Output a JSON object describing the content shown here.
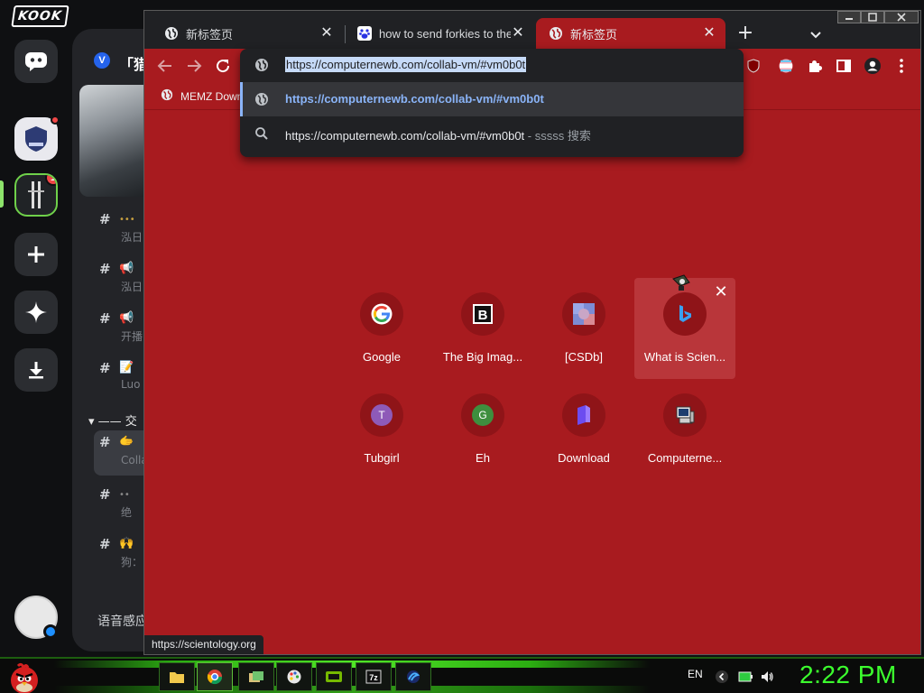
{
  "kook": {
    "logo": "KOOK",
    "server_badge": "1",
    "guild_letter": "V",
    "guild_name": "「猎",
    "channels": [
      {
        "emoji": "•••",
        "sub": "泓日"
      },
      {
        "emoji": "📢",
        "sub": "泓日"
      },
      {
        "emoji": "📢",
        "sub": "开播"
      },
      {
        "emoji": "📝",
        "sub": "Luo"
      },
      {
        "emoji": "🫱",
        "sub": "Colla"
      },
      {
        "emoji": "••",
        "sub": "绝"
      },
      {
        "emoji": "🙌",
        "sub": "狗："
      }
    ],
    "category": "—— 交",
    "voice_label": "语音感应"
  },
  "browser": {
    "tabs": [
      {
        "title": "新标签页",
        "favicon": "globe-icon"
      },
      {
        "title": "how to send forkies to the",
        "favicon": "baidu-paw-icon"
      },
      {
        "title": "新标签页",
        "favicon": "globe-icon"
      }
    ],
    "omnibox": {
      "value": "https://computernewb.com/collab-vm/#vm0b0t",
      "suggestions": [
        {
          "text": "https://computernewb.com/collab-vm/#vm0b0t",
          "icon": "globe-icon"
        },
        {
          "text": "https://computernewb.com/collab-vm/#vm0b0t",
          "suffix": " - sssss 搜索",
          "icon": "search-icon"
        }
      ]
    },
    "bookmarks": [
      {
        "label": "MEMZ Down",
        "icon": "globe-icon"
      }
    ],
    "shortcuts": [
      {
        "name": "Google"
      },
      {
        "name": "The Big Imag..."
      },
      {
        "name": "[CSDb]"
      },
      {
        "name": "What is Scien..."
      },
      {
        "name": "Tubgirl",
        "letter": "T",
        "color": "#8e5ab8"
      },
      {
        "name": "Eh",
        "letter": "G",
        "color": "#3e8e3e"
      },
      {
        "name": "Download"
      },
      {
        "name": "Computerne..."
      }
    ],
    "status_url": "https://scientology.org",
    "colors": {
      "theme": "#a81b1f",
      "frame": "#202124",
      "accent": "#8ab4f8"
    }
  },
  "taskbar": {
    "language": "EN",
    "clock": "2:22 PM"
  }
}
